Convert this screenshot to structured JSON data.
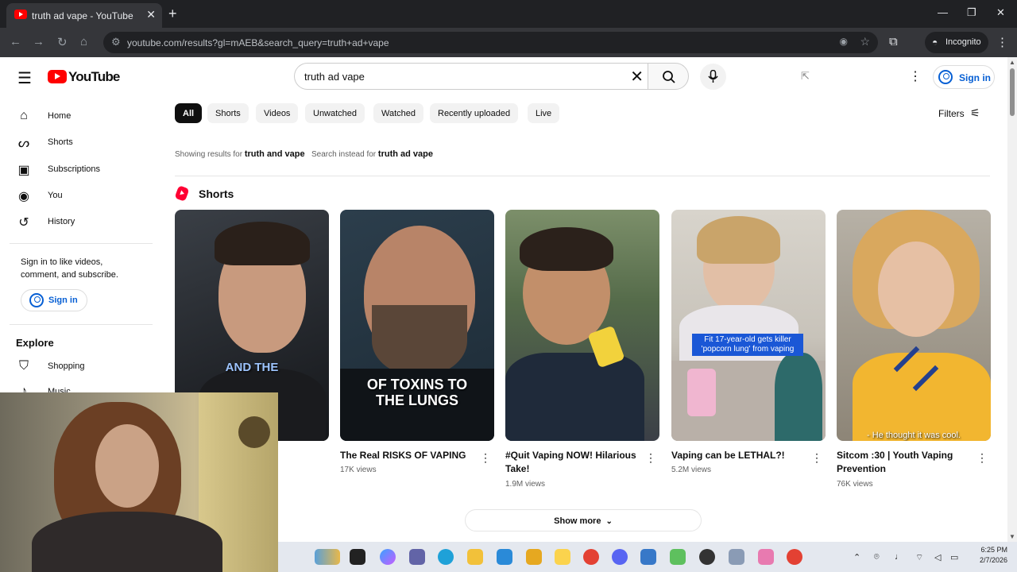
{
  "browser": {
    "tab_title": "truth ad vape - YouTube",
    "url": "youtube.com/results?gl=mAEB&search_query=truth+ad+vape",
    "incognito_label": "Incognito"
  },
  "header": {
    "logo_text": "YouTube",
    "search_value": "truth ad vape",
    "signin_label": "Sign in"
  },
  "sidebar": {
    "items": [
      {
        "label": "Home",
        "icon": "home-icon"
      },
      {
        "label": "Shorts",
        "icon": "shorts-icon"
      },
      {
        "label": "Subscriptions",
        "icon": "subscriptions-icon"
      },
      {
        "label": "You",
        "icon": "you-icon"
      },
      {
        "label": "History",
        "icon": "history-icon"
      }
    ],
    "signin_note": "Sign in to like videos, comment, and subscribe.",
    "signin_label": "Sign in",
    "explore_title": "Explore",
    "explore_items": [
      {
        "label": "Shopping",
        "icon": "shopping-icon"
      },
      {
        "label": "Music",
        "icon": "music-icon"
      }
    ]
  },
  "chips": [
    "All",
    "Shorts",
    "Videos",
    "Unwatched",
    "Watched",
    "Recently uploaded",
    "Live"
  ],
  "filters_label": "Filters",
  "spell": {
    "showing_prefix": "Showing results for",
    "corrected": "truth and vape",
    "instead_prefix": "Search instead for",
    "original": "truth ad vape"
  },
  "shorts": {
    "title": "Shorts",
    "cards": [
      {
        "title": "",
        "views": "",
        "overlay": "AND THE"
      },
      {
        "title": "The Real RISKS OF VAPING",
        "views": "17K views",
        "overlay": "OF TOXINS TO THE LUNGS"
      },
      {
        "title": "#Quit Vaping NOW! Hilarious Take!",
        "views": "1.9M views",
        "overlay": ""
      },
      {
        "title": "Vaping can be LETHAL?!",
        "views": "5.2M views",
        "overlay": "Fit 17-year-old gets killer 'popcorn lung' from vaping"
      },
      {
        "title": "Sitcom :30 | Youth Vaping Prevention",
        "views": "76K views",
        "overlay": "- He thought it was cool."
      }
    ],
    "show_more": "Show more"
  },
  "taskbar": {
    "time": "6:25 PM",
    "date": "2/7/2026"
  },
  "colors": {
    "youtube_red": "#ff0000",
    "link_blue": "#065fd4",
    "chip_active": "#0f0f0f"
  }
}
